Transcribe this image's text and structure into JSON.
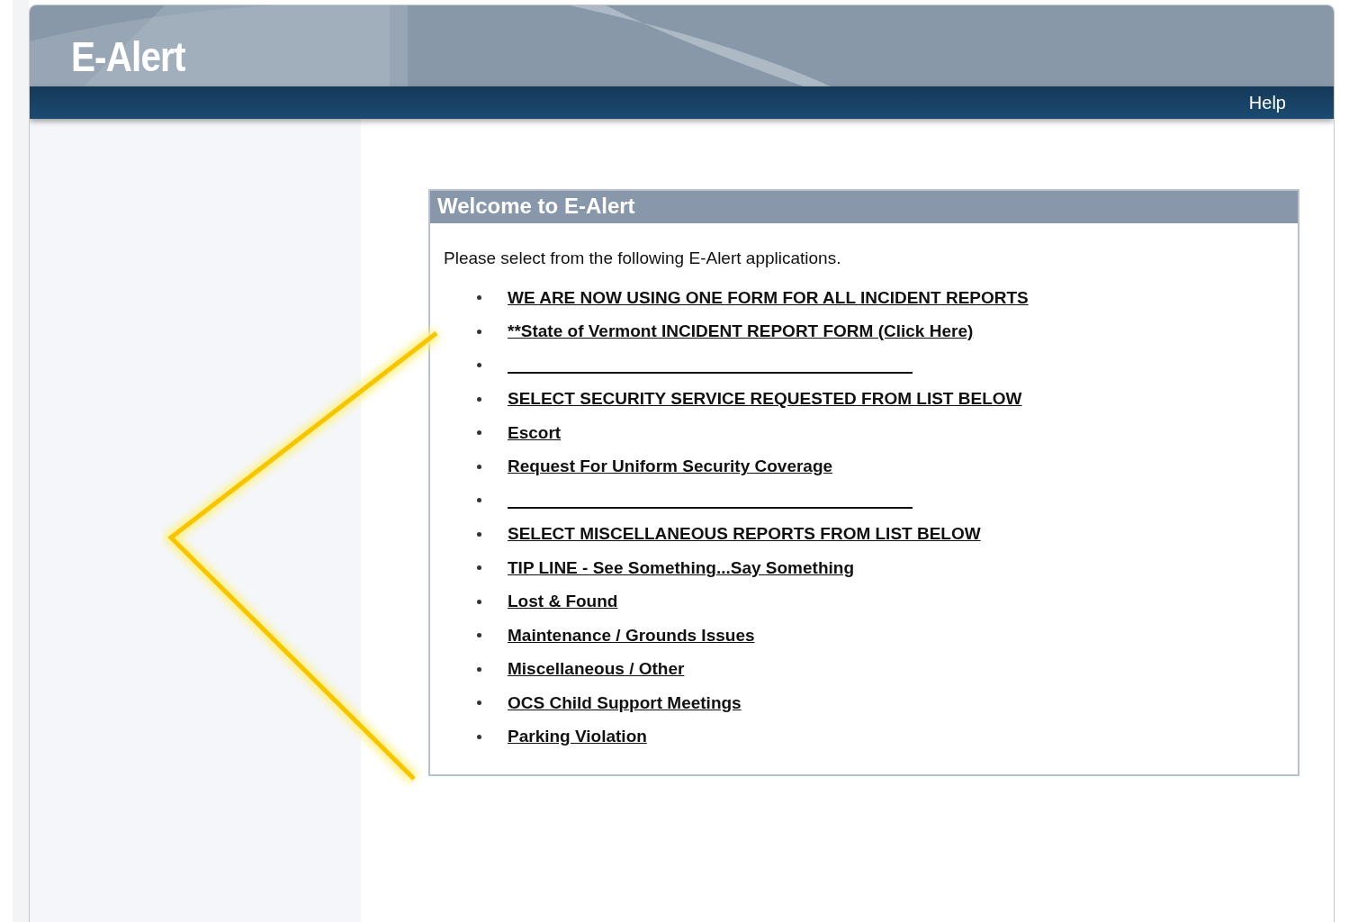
{
  "header": {
    "logo": "E-Alert",
    "nav": [
      "Help"
    ]
  },
  "panel": {
    "title": "Welcome to E-Alert",
    "intro": "Please select from the following E-Alert applications.",
    "items": [
      {
        "kind": "link",
        "label": "WE ARE NOW USING ONE FORM FOR ALL INCIDENT REPORTS"
      },
      {
        "kind": "link",
        "label": "**State of Vermont INCIDENT REPORT FORM (Click Here)"
      },
      {
        "kind": "separator"
      },
      {
        "kind": "link",
        "label": "SELECT SECURITY SERVICE REQUESTED FROM LIST BELOW"
      },
      {
        "kind": "link",
        "label": "Escort"
      },
      {
        "kind": "link",
        "label": "Request For Uniform Security Coverage"
      },
      {
        "kind": "separator"
      },
      {
        "kind": "link",
        "label": "SELECT MISCELLANEOUS REPORTS FROM LIST BELOW"
      },
      {
        "kind": "link",
        "label": "TIP LINE - See Something...Say Something"
      },
      {
        "kind": "link",
        "label": "Lost & Found"
      },
      {
        "kind": "link",
        "label": "Maintenance / Grounds Issues"
      },
      {
        "kind": "link",
        "label": "Miscellaneous / Other"
      },
      {
        "kind": "link",
        "label": "OCS Child Support Meetings"
      },
      {
        "kind": "link",
        "label": "Parking Violation"
      }
    ]
  }
}
